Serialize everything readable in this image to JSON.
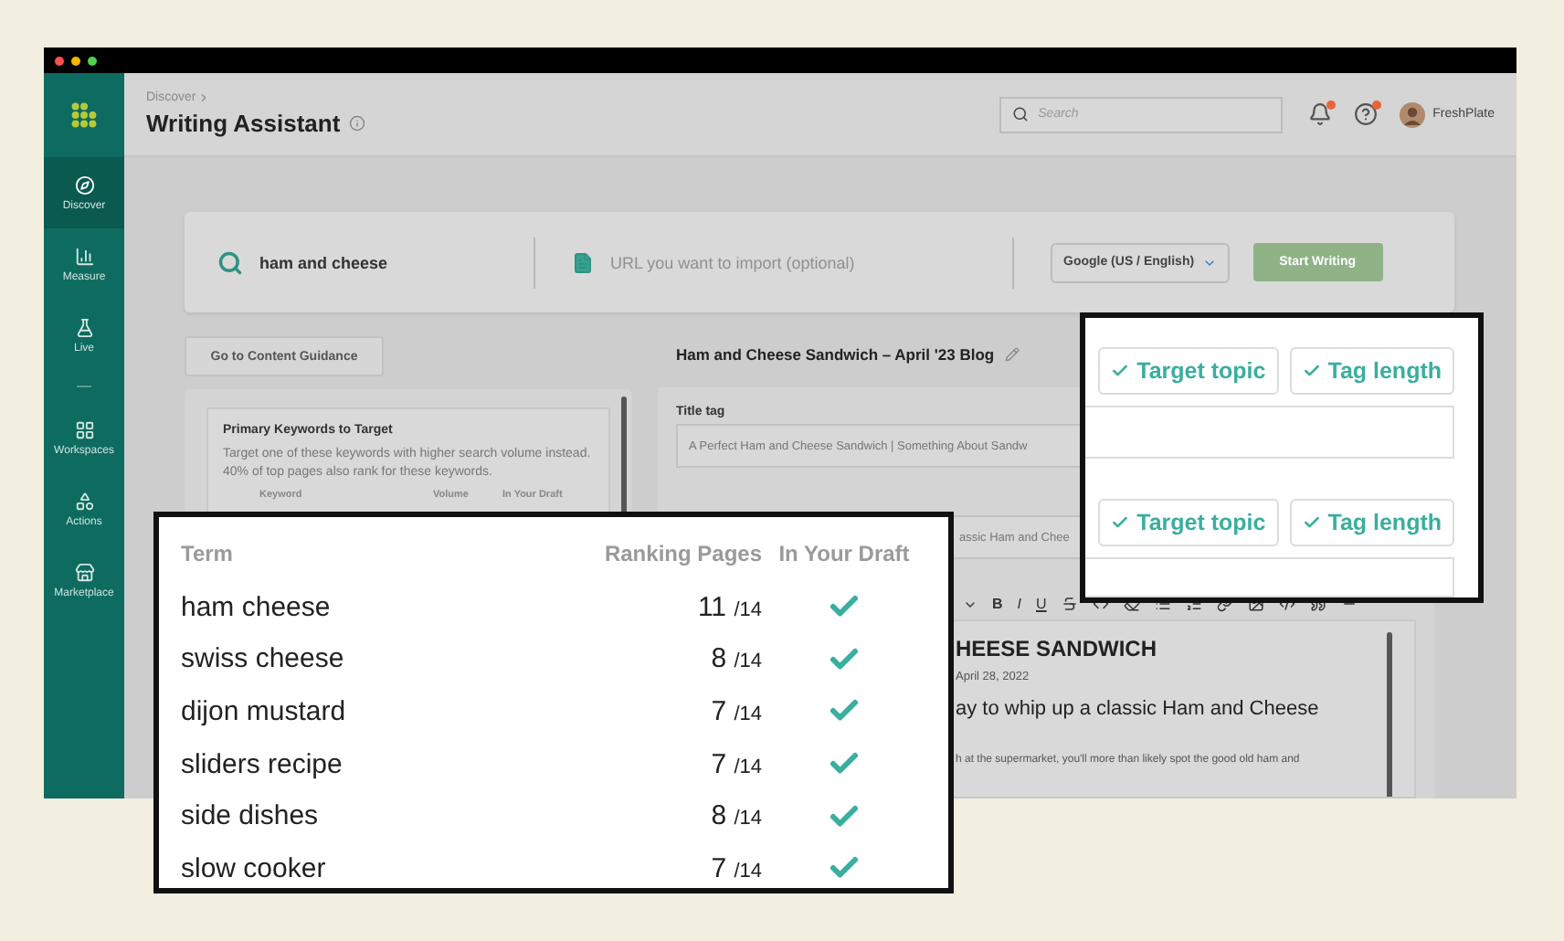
{
  "window": {
    "controls": [
      {
        "color": "#ff4f4f"
      },
      {
        "color": "#f5b400"
      },
      {
        "color": "#4fd04f"
      }
    ]
  },
  "sidebar": {
    "items": [
      {
        "label": "Discover",
        "selected": true
      },
      {
        "label": "Measure",
        "selected": false
      },
      {
        "label": "Live",
        "selected": false
      },
      {
        "label": "Workspaces",
        "selected": false
      },
      {
        "label": "Actions",
        "selected": false
      },
      {
        "label": "Marketplace",
        "selected": false
      }
    ]
  },
  "header": {
    "breadcrumb": "Discover",
    "title": "Writing Assistant",
    "search": {
      "placeholder": "Search"
    },
    "notifications_alert": true,
    "help_alert": true,
    "user": "FreshPlate"
  },
  "query": {
    "keyword": "ham and cheese",
    "url_placeholder": "URL you want to import (optional)",
    "engine": "Google (US / English)",
    "start_button": {
      "label": "Start Writing",
      "disabled": true
    }
  },
  "guidance_button": "Go to Content Guidance",
  "keyword_card": {
    "title": "Primary Keywords to Target",
    "description": "Target one of these keywords with higher search volume instead. 40% of top pages also rank for these keywords.",
    "columns": [
      "Keyword",
      "Volume",
      "In Your Draft"
    ]
  },
  "document": {
    "title": "Ham and Cheese Sandwich – April '23 Blog",
    "title_tag_label": "Title tag",
    "title_tag": "A Perfect Ham and Cheese Sandwich | Something About Sandw",
    "meta_description": "assic Ham and Chee",
    "toolbar": [
      "B",
      "I",
      "U"
    ],
    "heading": "HEESE SANDWICH",
    "date": "April 28, 2022",
    "subheading": "ay to whip up a classic Ham and Cheese",
    "body": "h at the supermarket, you'll more than likely spot the good old ham and"
  },
  "checks_panel": {
    "groups": [
      {
        "chips": [
          {
            "label": "Target topic",
            "checked": true
          },
          {
            "label": "Tag length",
            "checked": true
          }
        ]
      },
      {
        "chips": [
          {
            "label": "Target topic",
            "checked": true
          },
          {
            "label": "Tag length",
            "checked": true
          }
        ]
      }
    ]
  },
  "terms_panel": {
    "columns": [
      "Term",
      "Ranking Pages",
      "In Your Draft"
    ],
    "rows": [
      {
        "term": "ham cheese",
        "count": "11",
        "total": "/14",
        "in_draft": true
      },
      {
        "term": "swiss cheese",
        "count": "8",
        "total": "/14",
        "in_draft": true
      },
      {
        "term": "dijon mustard",
        "count": "7",
        "total": "/14",
        "in_draft": true
      },
      {
        "term": "sliders recipe",
        "count": "7",
        "total": "/14",
        "in_draft": true
      },
      {
        "term": "side dishes",
        "count": "8",
        "total": "/14",
        "in_draft": true
      },
      {
        "term": "slow cooker",
        "count": "7",
        "total": "/14",
        "in_draft": true
      }
    ]
  }
}
